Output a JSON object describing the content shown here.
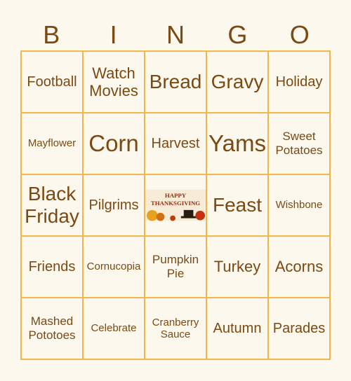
{
  "header": [
    "B",
    "I",
    "N",
    "G",
    "O"
  ],
  "cells": [
    {
      "text": "Football",
      "size": "s20"
    },
    {
      "text": "Watch Movies",
      "size": "s22"
    },
    {
      "text": "Bread",
      "size": "s26"
    },
    {
      "text": "Gravy",
      "size": "s26"
    },
    {
      "text": "Holiday",
      "size": "s20"
    },
    {
      "text": "Mayflower",
      "size": "s15"
    },
    {
      "text": "Corn",
      "size": "s32"
    },
    {
      "text": "Harvest",
      "size": "s20"
    },
    {
      "text": "Yams",
      "size": "s32"
    },
    {
      "text": "Sweet Potatoes",
      "size": "s17"
    },
    {
      "text": "Black Friday",
      "size": "s26"
    },
    {
      "text": "Pilgrims",
      "size": "s20"
    },
    {
      "text": "",
      "free": true,
      "image_caption": "Happy Thanksgiving"
    },
    {
      "text": "Feast",
      "size": "s26"
    },
    {
      "text": "Wishbone",
      "size": "s15"
    },
    {
      "text": "Friends",
      "size": "s20"
    },
    {
      "text": "Cornucopia",
      "size": "s15"
    },
    {
      "text": "Pumpkin Pie",
      "size": "s17"
    },
    {
      "text": "Turkey",
      "size": "s22"
    },
    {
      "text": "Acorns",
      "size": "s22"
    },
    {
      "text": "Mashed Pototoes",
      "size": "s17"
    },
    {
      "text": "Celebrate",
      "size": "s15"
    },
    {
      "text": "Cranberry Sauce",
      "size": "s15"
    },
    {
      "text": "Autumn",
      "size": "s20"
    },
    {
      "text": "Parades",
      "size": "s20"
    }
  ],
  "colors": {
    "text": "#7a4a12",
    "grid": "#f0b84a",
    "background": "#fcf8ee"
  }
}
